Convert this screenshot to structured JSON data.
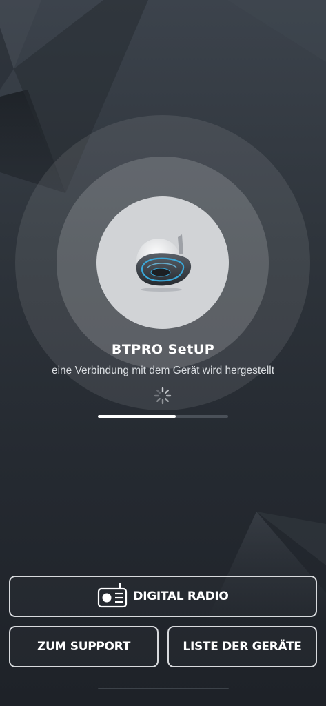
{
  "app": {
    "title": "BTPRO SetUP",
    "status": "eine Verbindung mit dem Gerät wird hergestellt",
    "progress_fraction": 0.6
  },
  "device": {
    "image": "bluetooth-intercom-device"
  },
  "spinner": {
    "icon": "loading-spinner-icon"
  },
  "buttons": {
    "digital_radio": {
      "label": "DIGITAL RADIO",
      "icon": "radio-icon"
    },
    "support": {
      "label": "ZUM SUPPORT"
    },
    "device_list": {
      "label": "LISTE DER GERÄTE"
    }
  },
  "colors": {
    "background_top": "#3c434c",
    "background_bottom": "#1e2228",
    "device_accent": "#3aa7d8",
    "button_border": "#d8dadd"
  }
}
